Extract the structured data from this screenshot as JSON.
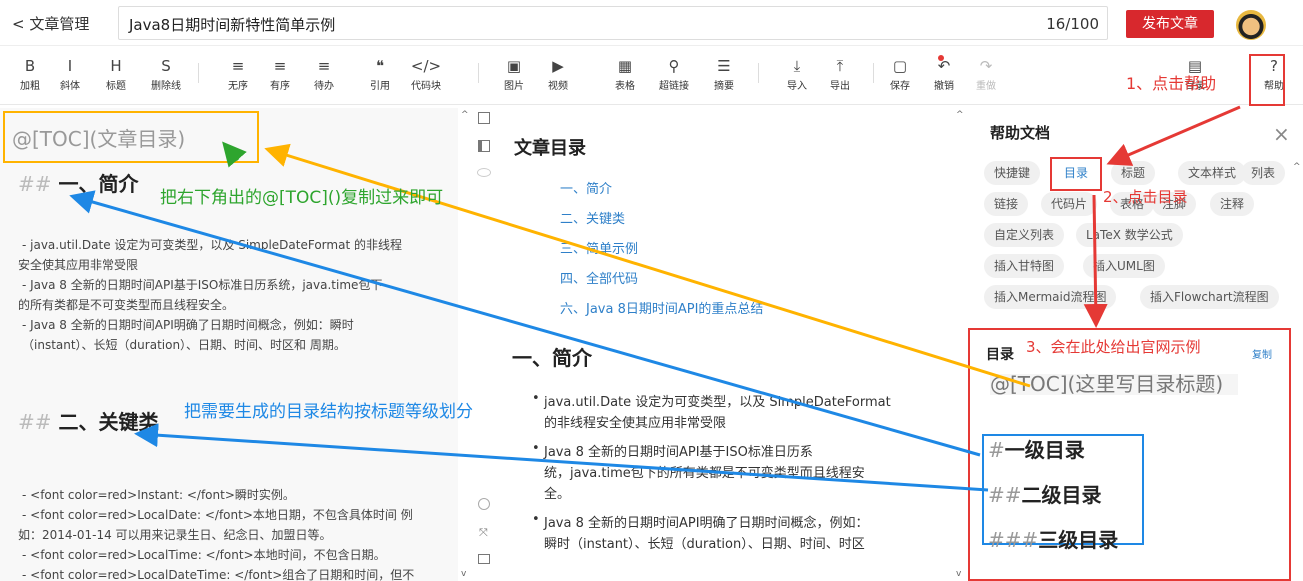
{
  "topbar": {
    "back_label": "文章管理",
    "title": "Java8日期时间新特性简单示例",
    "count": "16/100",
    "publish": "发布文章"
  },
  "toolbar": [
    {
      "icon": "B",
      "label": "加粗"
    },
    {
      "icon": "I",
      "label": "斜体"
    },
    {
      "icon": "H",
      "label": "标题"
    },
    {
      "icon": "S",
      "label": "删除线"
    },
    {
      "icon": "≡",
      "label": "无序"
    },
    {
      "icon": "≡",
      "label": "有序"
    },
    {
      "icon": "≡",
      "label": "待办"
    },
    {
      "icon": "❝",
      "label": "引用"
    },
    {
      "icon": "</>",
      "label": "代码块"
    },
    {
      "icon": "▣",
      "label": "图片"
    },
    {
      "icon": "▶",
      "label": "视频"
    },
    {
      "icon": "▦",
      "label": "表格"
    },
    {
      "icon": "⚲",
      "label": "超链接"
    },
    {
      "icon": "☰",
      "label": "摘要"
    },
    {
      "icon": "⤓",
      "label": "导入"
    },
    {
      "icon": "⤒",
      "label": "导出"
    },
    {
      "icon": "▢",
      "label": "保存"
    },
    {
      "icon": "↶",
      "label": "撤销"
    },
    {
      "icon": "↷",
      "label": "重做"
    },
    {
      "icon": "▤",
      "label": "目录"
    },
    {
      "icon": "?",
      "label": "帮助"
    }
  ],
  "editor": {
    "toc": "@[TOC](文章目录)",
    "h1": "一、简介",
    "h1_prefix": "##",
    "lines1": [
      "- java.util.Date 设定为可变类型，以及 SimpleDateFormat 的非线程",
      "安全使其应用非常受限",
      "- Java 8 全新的日期时间API基于ISO标准日历系统，java.time包下",
      "的所有类都是不可变类型而且线程安全。",
      "- Java 8 全新的日期时间API明确了日期时间概念，例如：瞬时",
      "（instant）、长短（duration）、日期、时间、时区和 周期。"
    ],
    "h2": "二、关键类",
    "h2_prefix": "##",
    "lines2": [
      "- <font color=red>Instant: </font>瞬时实例。",
      "- <font color=red>LocalDate: </font>本地日期，不包含具体时间 例",
      "如：2014-01-14 可以用来记录生日、纪念日、加盟日等。",
      "- <font color=red>LocalTime: </font>本地时间，不包含日期。",
      "- <font color=red>LocalDateTime: </font>组合了日期和时间，但不"
    ]
  },
  "preview": {
    "toc_title": "文章目录",
    "toc": [
      "一、简介",
      "二、关键类",
      "三、简单示例",
      "四、全部代码",
      "六、Java 8日期时间API的重点总结"
    ],
    "h1": "一、简介",
    "bullets": [
      [
        "java.util.Date 设定为可变类型，以及 SimpleDateFormat",
        "的非线程安全使其应用非常受限"
      ],
      [
        "Java 8 全新的日期时间API基于ISO标准日历系",
        "统，java.time包下的所有类都是不可变类型而且线程安",
        "全。"
      ],
      [
        "Java 8 全新的日期时间API明确了日期时间概念，例如：",
        "瞬时（instant）、长短（duration）、日期、时间、时区"
      ]
    ]
  },
  "help": {
    "title": "帮助文档",
    "close": "×",
    "chips": [
      "快捷键",
      "目录",
      "标题",
      "文本样式",
      "列表",
      "链接",
      "代码片",
      "表格",
      "注脚",
      "注释",
      "自定义列表",
      "LaTeX 数学公式",
      "插入甘特图",
      "插入UML图",
      "插入Mermaid流程图",
      "插入Flowchart流程图"
    ],
    "section": "目录",
    "copy": "复制",
    "toc": "@[TOC](这里写目录标题)",
    "levels": [
      {
        "prefix": "#",
        "text": "一级目录"
      },
      {
        "prefix": "##",
        "text": "二级目录"
      },
      {
        "prefix": "###",
        "text": "三级目录"
      }
    ]
  },
  "annotations": {
    "a1": "1、点击帮助",
    "a2": "2、点击目录",
    "a3": "3、会在此处给出官网示例",
    "green": "把右下角出的@[TOC]()复制过来即可",
    "blue": "把需要生成的目录结构按标题等级划分"
  },
  "colors": {
    "red": "#e53935",
    "green": "#2ea52e",
    "blue": "#1e88e5",
    "orange": "#ffb300",
    "link": "#2f80c9",
    "publish": "#d8282d"
  }
}
